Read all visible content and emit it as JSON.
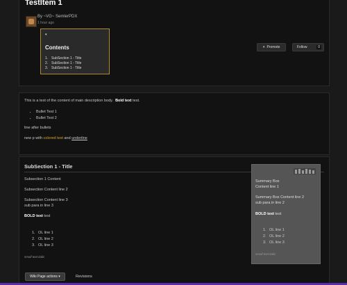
{
  "header": {
    "title": "TestItem 1",
    "byline": "By ~VG~ SemlerPDX",
    "time": "1 hour ago",
    "toc": {
      "toggle": "▾",
      "title": "Contents",
      "items": [
        {
          "num": "1.",
          "label": "SubSection 1 - Title"
        },
        {
          "num": "2.",
          "label": "SubSection 1 - Title"
        },
        {
          "num": "3.",
          "label": "SubSection 1 - Title"
        }
      ]
    },
    "promote_label": "Promote",
    "follow_label": "Follow",
    "follow_count": "0"
  },
  "body": {
    "intro_prefix": "This is a test of the content of main description body.",
    "intro_bold": "Bold text",
    "intro_suffix": "test.",
    "bullets": [
      "Bullet Test 1",
      "Bullet Test 2"
    ],
    "line_after": "line after bullets",
    "newp_prefix": "new p  with",
    "newp_colored": "colored text",
    "newp_and": "and",
    "newp_underline": "underline"
  },
  "section": {
    "title": "SubSection 1 - Title",
    "content1": "Subsection 1 Content",
    "content2": "Subsection Content line 2",
    "content3": "Subsection Content line 3",
    "sub_para": "sub para in line 3",
    "bold_prefix": "BOLD text",
    "bold_suffix": "test",
    "ol": [
      {
        "num": "1.",
        "label": "OL line 1"
      },
      {
        "num": "2.",
        "label": "OL line 2"
      },
      {
        "num": "3.",
        "label": "OL line 3"
      }
    ],
    "small_text": "small text italic",
    "summary": {
      "line1": "Summary Box",
      "line2": "Content line 1",
      "line3": "Summary Box Content line 2",
      "line4": "sub para in line 2",
      "bold": "BOLD text",
      "bold_suffix": "test",
      "ol": [
        {
          "num": "1.",
          "label": "OL line 1"
        },
        {
          "num": "2.",
          "label": "OL line 2"
        },
        {
          "num": "3.",
          "label": "OL line 3"
        }
      ],
      "small_text": "small text italic"
    }
  },
  "footer": {
    "wiki_actions": "Wiki Page actions ▾",
    "revisions": "Revisions"
  },
  "colors": {
    "accent_gold": "#d4a82a",
    "bottom_bar": "#5b2da8"
  }
}
